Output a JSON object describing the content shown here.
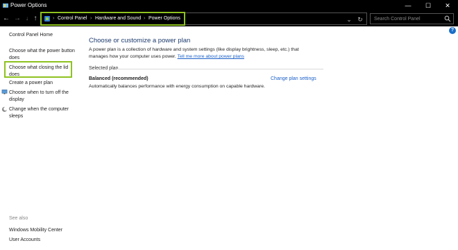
{
  "window": {
    "title": "Power Options",
    "controls": {
      "minimize": "—",
      "maximize": "☐",
      "close": "✕"
    }
  },
  "address_bar": {
    "nav": {
      "back": "←",
      "forward": "→",
      "up": "↑",
      "down": "↓"
    },
    "breadcrumb": [
      "Control Panel",
      "Hardware and Sound",
      "Power Options"
    ],
    "separator": "›",
    "dropdown": "⌄",
    "refresh": "↻",
    "search_placeholder": "Search Control Panel"
  },
  "help": {
    "label": "?"
  },
  "sidebar": {
    "home": "Control Panel Home",
    "items": [
      {
        "label": "Choose what the power button does",
        "icon": ""
      },
      {
        "label": "Choose what closing the lid does",
        "icon": ""
      },
      {
        "label": "Create a power plan",
        "icon": ""
      },
      {
        "label": "Choose when to turn off the display",
        "icon": "monitor-icon"
      },
      {
        "label": "Change when the computer sleeps",
        "icon": "moon-icon"
      }
    ],
    "see_also": "See also",
    "see_also_items": [
      "Windows Mobility Center",
      "User Accounts"
    ]
  },
  "main": {
    "title": "Choose or customize a power plan",
    "description": "A power plan is a collection of hardware and system settings (like display brightness, sleep, etc.) that manages how your computer uses power.",
    "description_link": "Tell me more about power plans",
    "section_label": "Selected plan",
    "plan": {
      "name": "Balanced (recommended)",
      "description": "Automatically balances performance with energy consumption on capable hardware.",
      "settings_link": "Change plan settings"
    }
  },
  "colors": {
    "highlight": "#8ec21f",
    "link": "#1a5fc8",
    "title": "#1c3a6e"
  }
}
